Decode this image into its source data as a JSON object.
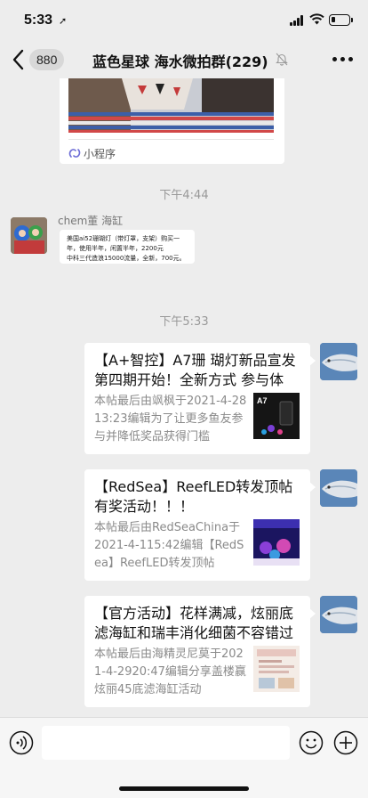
{
  "status_bar": {
    "time": "5:33",
    "location_arrow": "➚",
    "battery_level": 0.25
  },
  "nav": {
    "back_icon": "chevron-left-icon",
    "unread_count": "880",
    "title": "蓝色星球 海水微拍群(229)",
    "mute_icon": "bell-off-icon",
    "more_icon": "more-dots-icon"
  },
  "messages": {
    "mini_program": {
      "label": "小程序",
      "icon": "link-icon"
    },
    "time_1": "下午4:44",
    "chem_sender": "chem董 海缸",
    "chem_lines": [
      "美国ai52珊瑚灯（带灯罩，支架）购买一",
      "年，使用半年，闲置半年，2200元",
      "中科三代造浪15000流量，全新，700元。"
    ],
    "time_2": "下午5:33",
    "cards": [
      {
        "title": "【A+智控】A7珊 瑚灯新品宣发 第四期开始！全新方式 参与体验！",
        "desc": "本帖最后由飒枫于2021-4-2813:23编辑为了让更多鱼友参与并降低奖品获得门槛",
        "thumb_text": "A7"
      },
      {
        "title": "【RedSea】ReefLED转发顶帖有奖活动！！！",
        "desc": "本帖最后由RedSeaChina于2021-4-115:42编辑【RedSea】ReefLED转发顶帖"
      },
      {
        "title": "【官方活动】花样满减，炫丽底滤海缸和瑞丰消化细菌不容错过",
        "desc": "本帖最后由海精灵尼莫于2021-4-2920:47编辑分享盖楼赢炫丽45底滤海缸活动"
      }
    ]
  },
  "input_bar": {
    "voice_icon": "voice-icon",
    "emoji_icon": "emoji-icon",
    "plus_icon": "plus-icon",
    "placeholder": ""
  }
}
